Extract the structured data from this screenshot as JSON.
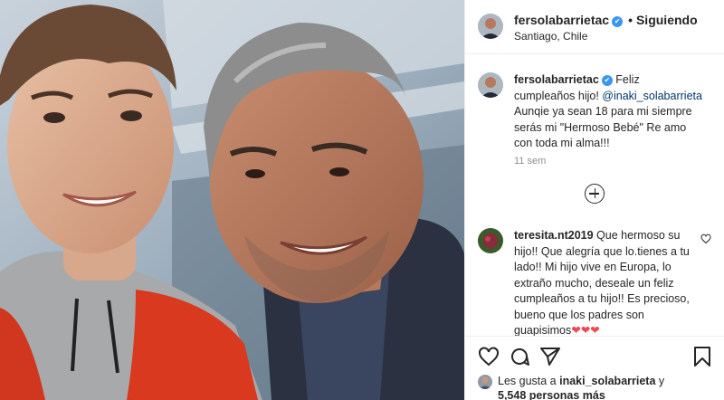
{
  "header": {
    "username": "fersolabarrietac",
    "verified_mark": "✔",
    "separator": "•",
    "follow_label": "Siguiendo",
    "location": "Santiago, Chile"
  },
  "caption": {
    "username": "fersolabarrietac",
    "text_before": "Feliz cumpleaños hijo! ",
    "mention": "@inaki_solabarrieta",
    "text_after": " Aunqie ya sean 18 para mi siempre serás mi \"Hermoso Bebé\" Re amo con toda mi alma!!!",
    "time": "11 sem"
  },
  "comment": {
    "username": "teresita.nt2019",
    "text": "Que hermoso su hijo!! Que alegría que lo.tienes a tu lado!! Mi hijo vive en Europa, lo extraño mucho, deseale un feliz cumpleaños a tu hijo!! Es precioso, bueno que los padres son guapisimos",
    "emoji": "❤❤❤"
  },
  "likes": {
    "prefix": "Les gusta a ",
    "user": "inaki_solabarrieta",
    "middle": " y",
    "count": "5,548 personas más"
  },
  "icons": {
    "verified": "verified-badge-icon",
    "load_more": "plus-circle-icon",
    "like": "heart-icon",
    "comment": "comment-bubble-icon",
    "share": "paper-plane-icon",
    "save": "bookmark-icon",
    "comment_like": "small-heart-icon"
  },
  "colors": {
    "verified_blue": "#3897f0",
    "mention": "#00376b",
    "secondary_text": "#8e8e8e",
    "divider": "#efefef",
    "emoji_red": "#ed4956"
  }
}
